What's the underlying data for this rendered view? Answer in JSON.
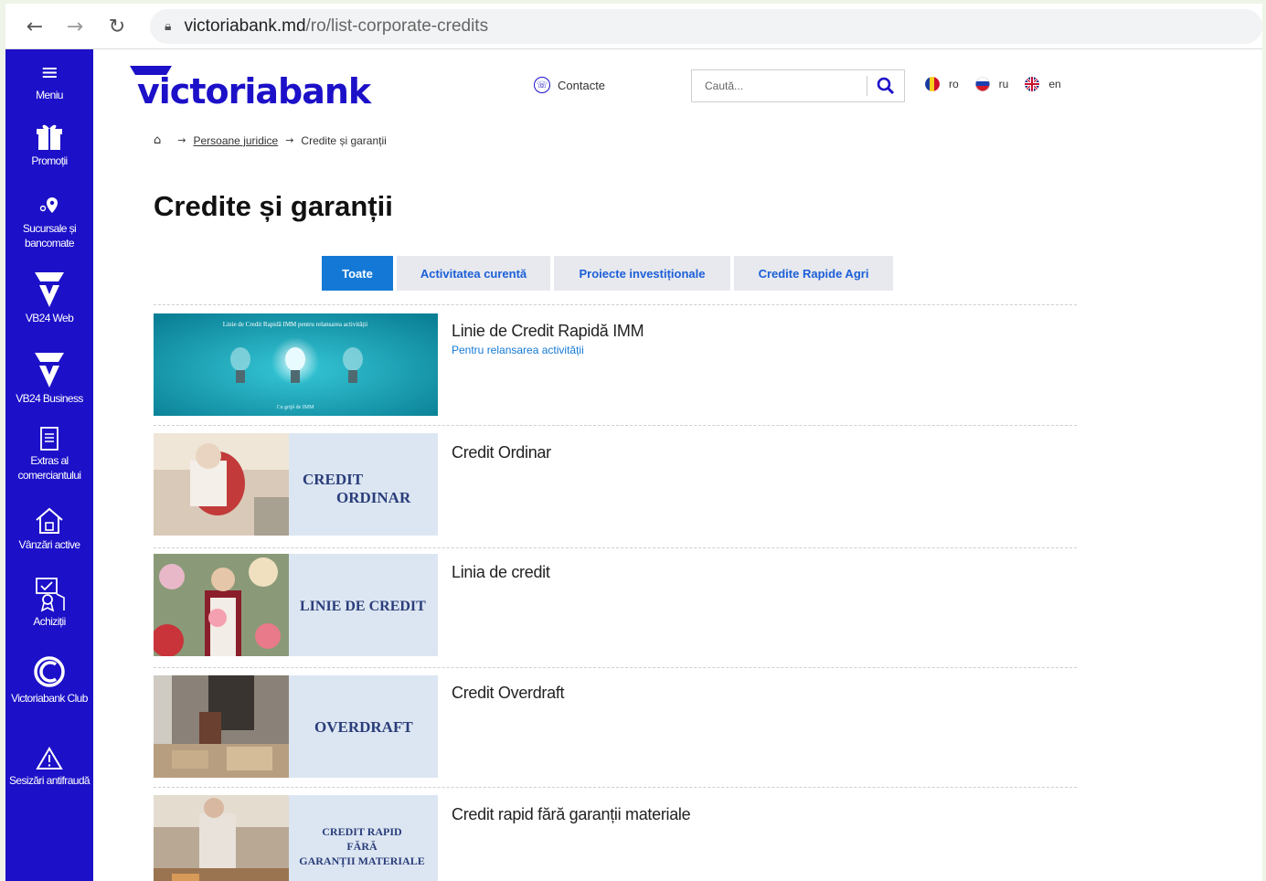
{
  "browser": {
    "url_host": "victoriabank.md",
    "url_path": "/ro/list-corporate-credits"
  },
  "sidebar": {
    "items": [
      {
        "label": "Meniu",
        "icon": "menu-icon"
      },
      {
        "label": "Promoții",
        "icon": "gift-icon"
      },
      {
        "label": "Sucursale și bancomate",
        "icon": "location-pin-icon"
      },
      {
        "label": "VB24 Web",
        "icon": "vb-logo-icon"
      },
      {
        "label": "VB24 Business",
        "icon": "vb-logo-icon"
      },
      {
        "label": "Extras al comerciantului",
        "icon": "document-icon"
      },
      {
        "label": "Vânzări active",
        "icon": "house-icon"
      },
      {
        "label": "Achiziții",
        "icon": "award-icon"
      },
      {
        "label": "Victoriabank Club",
        "icon": "club-icon"
      },
      {
        "label": "Sesizări antifraudă",
        "icon": "warning-icon"
      }
    ],
    "color": "#1c10c8"
  },
  "header": {
    "logo": "victoriabank",
    "contacts": "Contacte",
    "search_placeholder": "Caută...",
    "languages": [
      {
        "code": "ro"
      },
      {
        "code": "ru"
      },
      {
        "code": "en"
      }
    ]
  },
  "breadcrumb": {
    "link": "Persoane juridice",
    "current": "Credite și garanții"
  },
  "page_title": "Credite și garanții",
  "tabs": [
    {
      "label": "Toate",
      "active": true
    },
    {
      "label": "Activitatea curentă",
      "active": false
    },
    {
      "label": "Proiecte investiționale",
      "active": false
    },
    {
      "label": "Credite Rapide Agri",
      "active": false
    }
  ],
  "products": [
    {
      "title": "Linie de Credit Rapidă IMM",
      "subtitle": "Pentru relansarea activității",
      "banner_text": "Linie de Credit Rapidă IMM pentru relansarea activității",
      "banner_small": "Cu grijă de IMM"
    },
    {
      "title": "Credit Ordinar",
      "banner_line1": "CREDIT",
      "banner_line2": "ORDINAR"
    },
    {
      "title": "Linia de credit",
      "banner_line1": "LINIE DE CREDIT"
    },
    {
      "title": "Credit Overdraft",
      "banner_line1": "OVERDRAFT"
    },
    {
      "title": "Credit rapid fără garanții materiale",
      "banner_line1": "CREDIT RAPID",
      "banner_line2": "FĂRĂ",
      "banner_line3": "GARANȚII MATERIALE"
    }
  ],
  "colors": {
    "brand_blue": "#1c10c8",
    "tab_active": "#1479d6",
    "link_blue": "#1479d6"
  }
}
